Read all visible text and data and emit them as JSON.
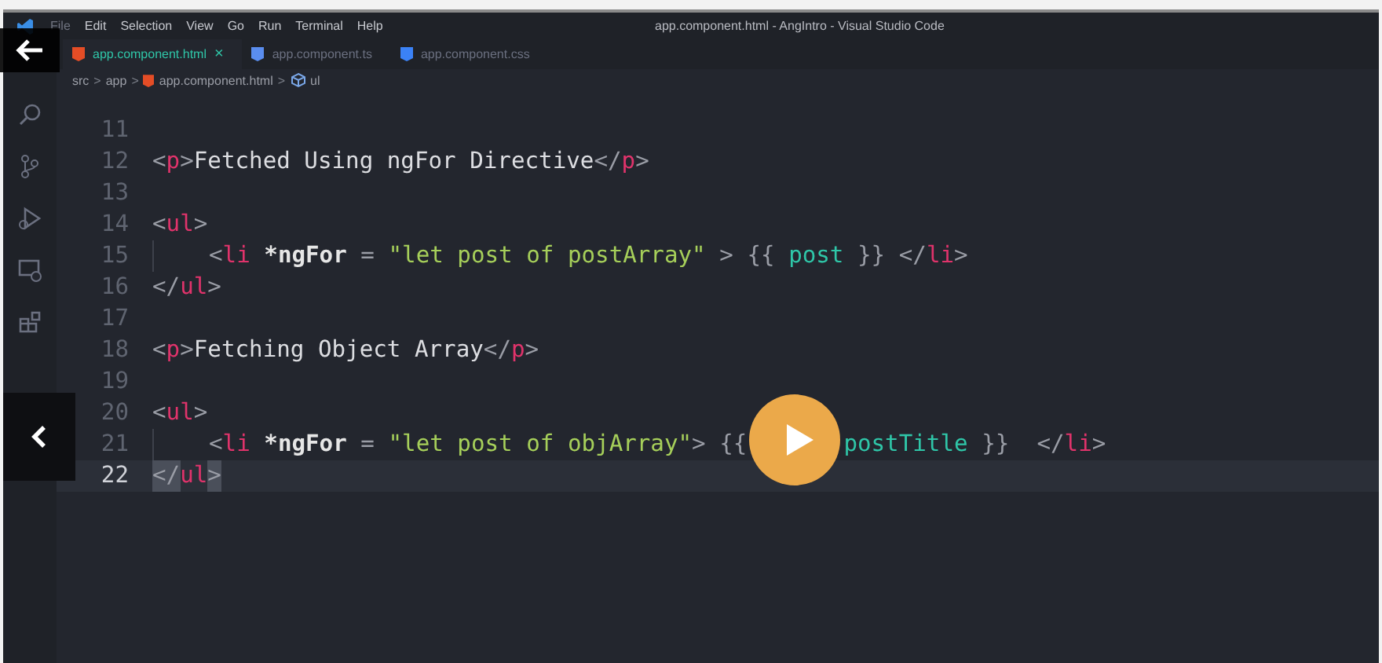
{
  "window": {
    "title": "app.component.html - AngIntro - Visual Studio Code"
  },
  "menu": [
    "File",
    "Edit",
    "Selection",
    "View",
    "Go",
    "Run",
    "Terminal",
    "Help"
  ],
  "tabs": [
    {
      "label": "app.component.html",
      "color": "#e44d26",
      "selected": true,
      "close": "×"
    },
    {
      "label": "app.component.ts",
      "color": "#5a8dee",
      "selected": false
    },
    {
      "label": "app.component.css",
      "color": "#3b82f6",
      "selected": false
    }
  ],
  "breadcrumb": [
    "src",
    "app",
    "app.component.html",
    "ul"
  ],
  "breadcrumb_separator": ">",
  "editor": {
    "lines": [
      {
        "number": "11",
        "current": false,
        "indent": false
      },
      {
        "number": "12",
        "current": false,
        "indent": false,
        "tokens": [
          {
            "kind": "punct",
            "text": "<"
          },
          {
            "kind": "tag",
            "text": "p"
          },
          {
            "kind": "punct",
            "text": ">"
          },
          {
            "kind": "text",
            "text": "Fetched Using ngFor Directive"
          },
          {
            "kind": "punct",
            "text": "</"
          },
          {
            "kind": "tag",
            "text": "p"
          },
          {
            "kind": "punct",
            "text": ">"
          }
        ]
      },
      {
        "number": "13",
        "current": false,
        "indent": false
      },
      {
        "number": "14",
        "current": false,
        "indent": false,
        "tokens": [
          {
            "kind": "punct",
            "text": "<"
          },
          {
            "kind": "tag",
            "text": "ul"
          },
          {
            "kind": "punct",
            "text": ">"
          }
        ]
      },
      {
        "number": "15",
        "current": false,
        "indent": true,
        "tokens": [
          {
            "kind": "punct",
            "text": "<"
          },
          {
            "kind": "tag",
            "text": "li"
          },
          {
            "kind": "attr",
            "text": " *ngFor"
          },
          {
            "kind": "punct",
            "text": " = "
          },
          {
            "kind": "string",
            "text": "\"let post of postArray\""
          },
          {
            "kind": "punct",
            "text": " > {{ "
          },
          {
            "kind": "interp",
            "text": "post"
          },
          {
            "kind": "punct",
            "text": " }} </"
          },
          {
            "kind": "tag",
            "text": "li"
          },
          {
            "kind": "punct",
            "text": ">"
          }
        ]
      },
      {
        "number": "16",
        "current": false,
        "indent": false,
        "tokens": [
          {
            "kind": "punct",
            "text": "</"
          },
          {
            "kind": "tag",
            "text": "ul"
          },
          {
            "kind": "punct",
            "text": ">"
          }
        ]
      },
      {
        "number": "17",
        "current": false,
        "indent": false
      },
      {
        "number": "18",
        "current": false,
        "indent": false,
        "tokens": [
          {
            "kind": "punct",
            "text": "<"
          },
          {
            "kind": "tag",
            "text": "p"
          },
          {
            "kind": "punct",
            "text": ">"
          },
          {
            "kind": "text",
            "text": "Fetching Object Array"
          },
          {
            "kind": "punct",
            "text": "</"
          },
          {
            "kind": "tag",
            "text": "p"
          },
          {
            "kind": "punct",
            "text": ">"
          }
        ]
      },
      {
        "number": "19",
        "current": false,
        "indent": false
      },
      {
        "number": "20",
        "current": false,
        "indent": false,
        "tokens": [
          {
            "kind": "punct",
            "text": "<"
          },
          {
            "kind": "tag",
            "text": "ul"
          },
          {
            "kind": "punct",
            "text": ">"
          }
        ]
      },
      {
        "number": "21",
        "current": false,
        "indent": true,
        "tokens": [
          {
            "kind": "punct",
            "text": "<"
          },
          {
            "kind": "tag",
            "text": "li"
          },
          {
            "kind": "attr",
            "text": " *ngFor"
          },
          {
            "kind": "punct",
            "text": " = "
          },
          {
            "kind": "string",
            "text": "\"let post of objArray\""
          },
          {
            "kind": "punct",
            "text": "> {{"
          },
          {
            "kind": "covered_interp",
            "text": "postTitle"
          },
          {
            "kind": "punct",
            "text": " }}  </"
          },
          {
            "kind": "tag",
            "text": "li"
          },
          {
            "kind": "punct",
            "text": ">"
          }
        ]
      },
      {
        "number": "22",
        "current": true,
        "indent": false,
        "tokens": [
          {
            "kind": "bracket",
            "text": "</"
          },
          {
            "kind": "tag",
            "text": "ul"
          },
          {
            "kind": "bracket",
            "text": ">"
          }
        ]
      }
    ]
  }
}
